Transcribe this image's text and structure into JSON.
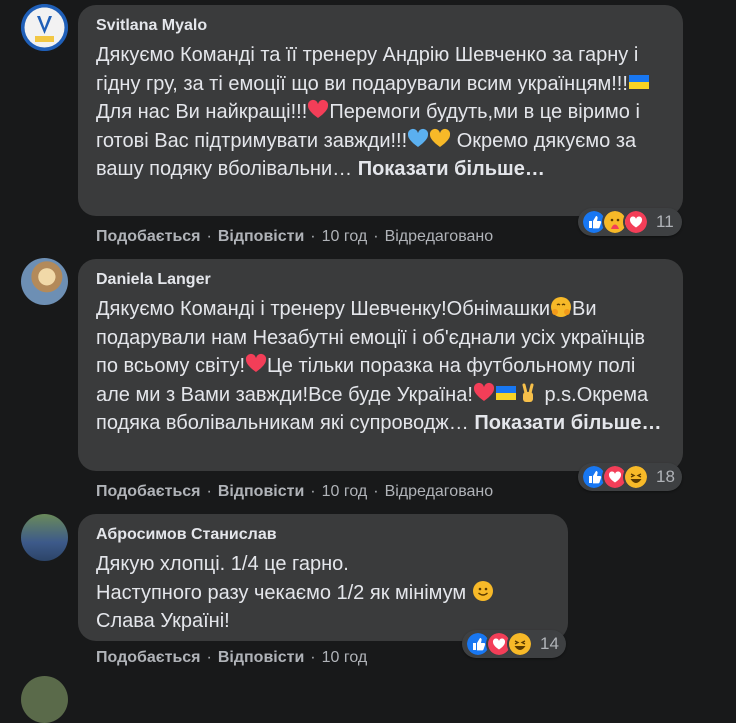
{
  "comments": [
    {
      "author": "Svitlana Myalo",
      "text": "Дякуємо Команді та її тренеру Андрію Шевченко за гарну і гідну гру, за ті емоції що ви подарували всим українцям!!!",
      "text_b": "Для нас Ви найкращі!!!",
      "text_c": "Перемоги будуть,ми в це віримо і готові Вас підтримувати завжди!!!",
      "text_d": " Окремо дякуємо за вашу подяку вболівальни… ",
      "more": "Показати більше…",
      "reactions": [
        "like",
        "care",
        "love"
      ],
      "reaction_count": "11",
      "like_label": "Подобається",
      "reply_label": "Відповісти",
      "time": "10 год",
      "edited": "Відредаговано"
    },
    {
      "author": "Daniela Langer",
      "text": "Дякуємо Команді і тренеру Шевченку!Обнімашки",
      "text_b": "Ви подарували нам Незабутні емоції і об'єднали усіх українців по всьому світу!",
      "text_c": "Це тільки поразка на футбольному полі але ми з Вами завжди!Все буде Україна!",
      "text_d": " p.s.Окрема подяка вболівальникам які супроводж… ",
      "more": "Показати більше…",
      "reactions": [
        "like",
        "love",
        "haha"
      ],
      "reaction_count": "18",
      "like_label": "Подобається",
      "reply_label": "Відповісти",
      "time": "10 год",
      "edited": "Відредаговано"
    },
    {
      "author": "Абросимов Станислав",
      "line1": "Дякую хлопці. 1/4 це гарно.",
      "line2": "Наступного разу чекаємо 1/2 як мінімум",
      "line3": "Слава Україні!",
      "reactions": [
        "like",
        "love",
        "haha"
      ],
      "reaction_count": "14",
      "like_label": "Подобається",
      "reply_label": "Відповісти",
      "time": "10 год"
    }
  ],
  "colors": {
    "background": "#18191a",
    "bubble": "#3a3b3c",
    "text": "#e4e6eb",
    "secondary_text": "#b0b3b8",
    "like_blue": "#1877f2",
    "love_red": "#f33e58",
    "emoji_yellow": "#f7b928"
  }
}
